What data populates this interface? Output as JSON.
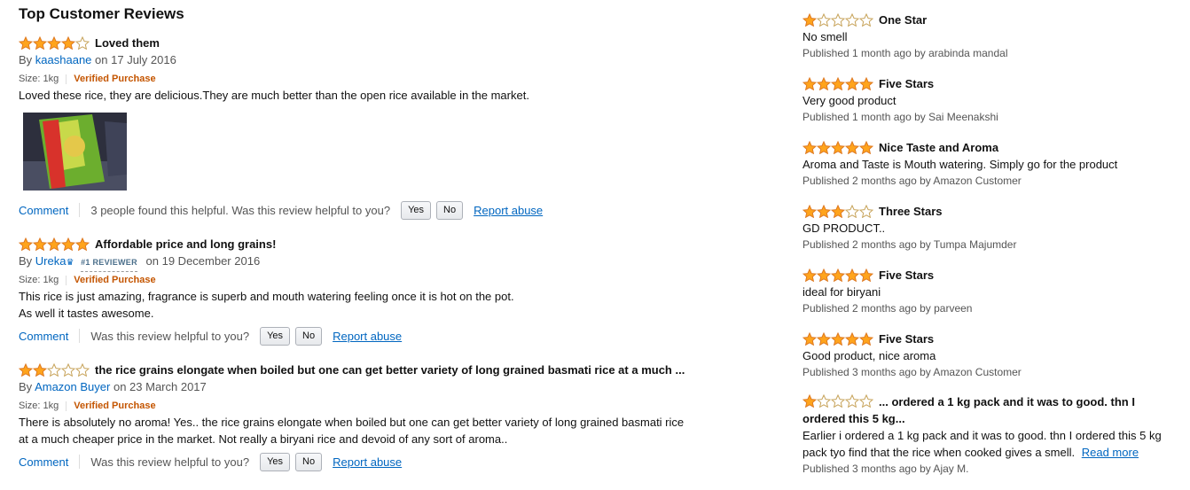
{
  "section_title": "Top Customer Reviews",
  "colors": {
    "star_fill": "#ffa41c",
    "star_stroke": "#de7921",
    "link": "#0066c0",
    "verified": "#c45500"
  },
  "reviews": [
    {
      "rating": 4,
      "title": "Loved them",
      "by_prefix": "By",
      "author": "kaashaane",
      "date": "on 17 July 2016",
      "size": "Size: 1kg",
      "verified": "Verified Purchase",
      "body": "Loved these rice, they are delicious.They are much better than the open rice available in the market.",
      "has_image": true,
      "comment": "Comment",
      "helpful_text": "3 people found this helpful. Was this review helpful to you?",
      "yes": "Yes",
      "no": "No",
      "report": "Report abuse"
    },
    {
      "rating": 5,
      "title": "Affordable price and long grains!",
      "by_prefix": "By",
      "author": "Ureka",
      "badge": "#1 REVIEWER",
      "date": "on 19 December 2016",
      "size": "Size: 1kg",
      "verified": "Verified Purchase",
      "body_lines": [
        "This rice is just amazing, fragrance is superb and mouth watering feeling once it is hot on the pot.",
        "As well it tastes awesome."
      ],
      "comment": "Comment",
      "helpful_text": "Was this review helpful to you?",
      "yes": "Yes",
      "no": "No",
      "report": "Report abuse"
    },
    {
      "rating": 2,
      "title": "the rice grains elongate when boiled but one can get better variety of long grained basmati rice at a much ...",
      "by_prefix": "By",
      "author": "Amazon Buyer",
      "date": "on 23 March 2017",
      "size": "Size: 1kg",
      "verified": "Verified Purchase",
      "body_lines": [
        "There is absolutely no aroma! Yes.. the rice grains elongate when boiled but one can get better variety of long grained basmati rice",
        "at a much cheaper price in the market. Not really a biryani rice and devoid of any sort of aroma.."
      ],
      "comment": "Comment",
      "helpful_text": "Was this review helpful to you?",
      "yes": "Yes",
      "no": "No",
      "report": "Report abuse"
    }
  ],
  "recent_reviews": [
    {
      "rating": 1,
      "title": "One Star",
      "text": "No smell",
      "published": "Published 1 month ago by arabinda mandal"
    },
    {
      "rating": 5,
      "title": "Five Stars",
      "text": "Very good product",
      "published": "Published 1 month ago by Sai Meenakshi"
    },
    {
      "rating": 5,
      "title": "Nice Taste and Aroma",
      "text": "Aroma and Taste is Mouth watering. Simply go for the product",
      "published": "Published 2 months ago by Amazon Customer"
    },
    {
      "rating": 3,
      "title": "Three Stars",
      "text": "GD PRODUCT..",
      "published": "Published 2 months ago by Tumpa Majumder"
    },
    {
      "rating": 5,
      "title": "Five Stars",
      "text": "ideal for biryani",
      "published": "Published 2 months ago by parveen"
    },
    {
      "rating": 5,
      "title": "Five Stars",
      "text": "Good product, nice aroma",
      "published": "Published 3 months ago by Amazon Customer"
    },
    {
      "rating": 1,
      "title": "... ordered a 1 kg pack and it was to good. thn I ordered this 5 kg...",
      "text": "Earlier i ordered a 1 kg pack and it was to good. thn I ordered this 5 kg pack tyo find that the rice when cooked gives a smell.",
      "read_more": "Read more",
      "published": "Published 3 months ago by Ajay M."
    }
  ]
}
